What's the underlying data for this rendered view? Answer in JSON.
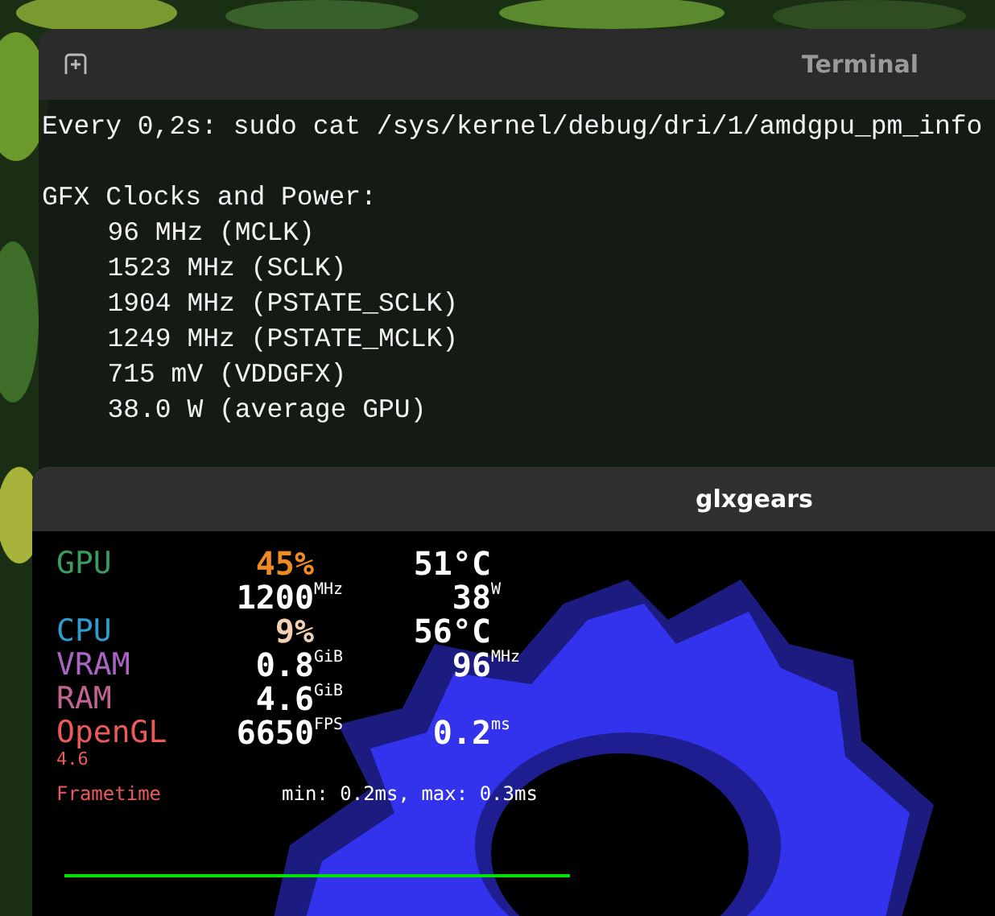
{
  "terminal": {
    "title": "Terminal",
    "blocks": [
      [
        "Every 0,2s: sudo cat /sys/kernel/debug/dri/1/amdgpu_pm_info"
      ],
      [
        "GFX Clocks and Power:",
        "\t96 MHz (MCLK)",
        "\t1523 MHz (SCLK)",
        "\t1904 MHz (PSTATE_SCLK)",
        "\t1249 MHz (PSTATE_MCLK)",
        "\t715 mV (VDDGFX)",
        "\t38.0 W (average GPU)"
      ]
    ]
  },
  "glxgears": {
    "title": "glxgears",
    "hud": {
      "rows": [
        {
          "label": "GPU",
          "color": "#3a9c63",
          "cells": [
            {
              "value": "45%",
              "color": "#f28a24"
            },
            {
              "value": "51°C",
              "color": "#ffffff"
            }
          ]
        },
        {
          "cells": [
            {
              "value": "1200",
              "unit": "MHz",
              "color": "#ffffff"
            },
            {
              "value": "38",
              "unit": "W",
              "color": "#ffffff"
            }
          ]
        },
        {
          "label": "CPU",
          "color": "#2f9dd0",
          "cells": [
            {
              "value": "9%",
              "color": "#f4cfb2"
            },
            {
              "value": "56°C",
              "color": "#ffffff"
            }
          ]
        },
        {
          "label": "VRAM",
          "color": "#a964c4",
          "cells": [
            {
              "value": "0.8",
              "unit": "GiB",
              "color": "#ffffff"
            },
            {
              "value": "96",
              "unit": "MHz",
              "color": "#ffffff"
            }
          ]
        },
        {
          "label": "RAM",
          "color": "#c06491",
          "cells": [
            {
              "value": "4.6",
              "unit": "GiB",
              "color": "#ffffff"
            }
          ]
        },
        {
          "label": "OpenGL",
          "color": "#ea5a5a",
          "sublabel": "4.6",
          "cells": [
            {
              "value": "6650",
              "unit": "FPS",
              "color": "#ffffff"
            },
            {
              "value": "0.2",
              "unit": "ms",
              "color": "#ffffff"
            }
          ]
        }
      ],
      "frametime": {
        "label": "Frametime",
        "stats": "min: 0.2ms, max: 0.3ms"
      }
    }
  }
}
